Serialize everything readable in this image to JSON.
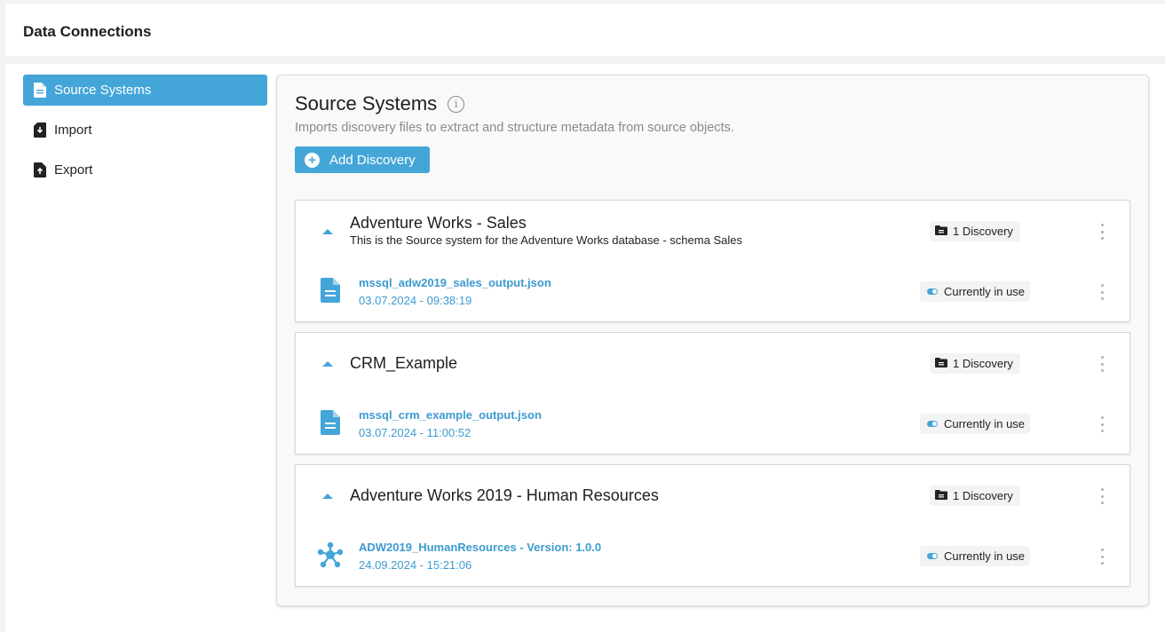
{
  "app": {
    "title": "Data Connections"
  },
  "nav": {
    "items": [
      {
        "label": "Source Systems",
        "icon": "document-icon",
        "active": true
      },
      {
        "label": "Import",
        "icon": "import-icon",
        "active": false
      },
      {
        "label": "Export",
        "icon": "export-icon",
        "active": false
      }
    ]
  },
  "panel": {
    "title": "Source Systems",
    "info_glyph": "i",
    "subtitle": "Imports discovery files to extract and structure metadata from source objects.",
    "add_button": "Add Discovery"
  },
  "sources": [
    {
      "title": "Adventure Works - Sales",
      "description": "This is the Source system for the Adventure Works database - schema Sales",
      "badge": "1 Discovery",
      "file": {
        "name": "mssql_adw2019_sales_output.json",
        "version": "",
        "date": "03.07.2024 - 09:38:19",
        "icon": "file-icon"
      },
      "status": "Currently in use"
    },
    {
      "title": "CRM_Example",
      "description": "",
      "badge": "1 Discovery",
      "file": {
        "name": "mssql_crm_example_output.json",
        "version": "",
        "date": "03.07.2024 - 11:00:52",
        "icon": "file-icon"
      },
      "status": "Currently in use"
    },
    {
      "title": "Adventure Works 2019 - Human Resources",
      "description": "",
      "badge": "1 Discovery",
      "file": {
        "name": "ADW2019_HumanResources",
        "version": " - Version: 1.0.0",
        "date": "24.09.2024 - 15:21:06",
        "icon": "network-icon"
      },
      "status": "Currently in use"
    }
  ],
  "colors": {
    "accent": "#44a5d8",
    "link": "#3c9bd0",
    "background": "#f2f2f2"
  }
}
